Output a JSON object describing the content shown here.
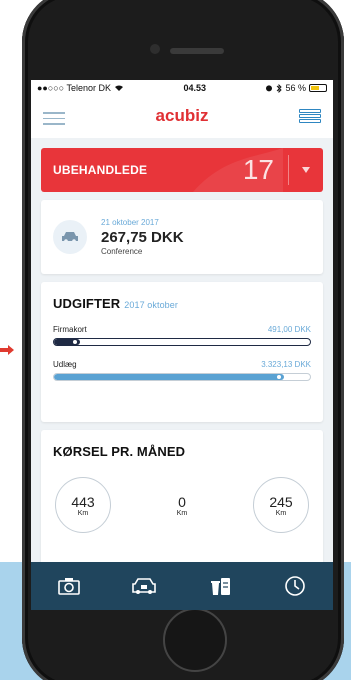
{
  "status": {
    "carrier": "●●○○○ Telenor DK",
    "time": "04.53",
    "battery_pct": "56 %"
  },
  "app": {
    "brand": "acubiz"
  },
  "unprocessed": {
    "label": "UBEHANDLEDE",
    "count": "17"
  },
  "latest_expense": {
    "date": "21 oktober 2017",
    "amount": "267,75 DKK",
    "category": "Conference",
    "icon": "car-icon"
  },
  "expenses": {
    "title": "UDGIFTER",
    "period": "2017 oktober",
    "rows": [
      {
        "label": "Firmakort",
        "value": "491,00 DKK",
        "fill": 0.1,
        "color": "#1f2a44"
      },
      {
        "label": "Udlæg",
        "value": "3.323,13 DKK",
        "fill": 0.9,
        "color": "#5aa2d3"
      }
    ]
  },
  "driving": {
    "title": "KØRSEL PR. MÅNED",
    "months": [
      {
        "value": "443",
        "unit": "Km"
      },
      {
        "value": "0",
        "unit": "Km"
      },
      {
        "value": "245",
        "unit": "Km"
      }
    ]
  },
  "tabs": [
    "camera-icon",
    "car-icon",
    "coffee-receipt-icon",
    "clock-icon"
  ],
  "colors": {
    "accent": "#e8353a",
    "navy": "#20455d",
    "blue": "#5aa2d3"
  }
}
